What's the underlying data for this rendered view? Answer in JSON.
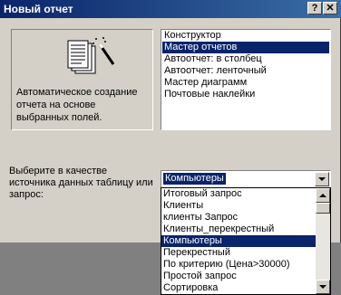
{
  "window": {
    "title": "Новый отчет",
    "help_label": "?",
    "close_label": "✕"
  },
  "preview": {
    "description": "Автоматическое создание отчета на основе выбранных полей."
  },
  "report_types": {
    "items": [
      {
        "label": "Конструктор",
        "selected": false
      },
      {
        "label": "Мастер отчетов",
        "selected": true
      },
      {
        "label": "Автоотчет: в столбец",
        "selected": false
      },
      {
        "label": "Автоотчет: ленточный",
        "selected": false
      },
      {
        "label": "Мастер диаграмм",
        "selected": false
      },
      {
        "label": "Почтовые наклейки",
        "selected": false
      }
    ]
  },
  "source": {
    "label": "Выберите в качестве источника данных таблицу или запрос:",
    "value": "Компьютеры",
    "options": [
      {
        "label": "Итоговый запрос",
        "selected": false
      },
      {
        "label": "Клиенты",
        "selected": false
      },
      {
        "label": "клиенты Запрос",
        "selected": false
      },
      {
        "label": "Клиенты_перекрестный",
        "selected": false
      },
      {
        "label": "Компьютеры",
        "selected": true
      },
      {
        "label": "Перекрестный",
        "selected": false
      },
      {
        "label": "По критерию (Цена>30000)",
        "selected": false
      },
      {
        "label": "Простой запрос",
        "selected": false
      },
      {
        "label": "Сортировка",
        "selected": false
      }
    ]
  },
  "colors": {
    "title_bar": "#0a246a",
    "selection": "#0a246a",
    "face": "#d4d0c8"
  }
}
